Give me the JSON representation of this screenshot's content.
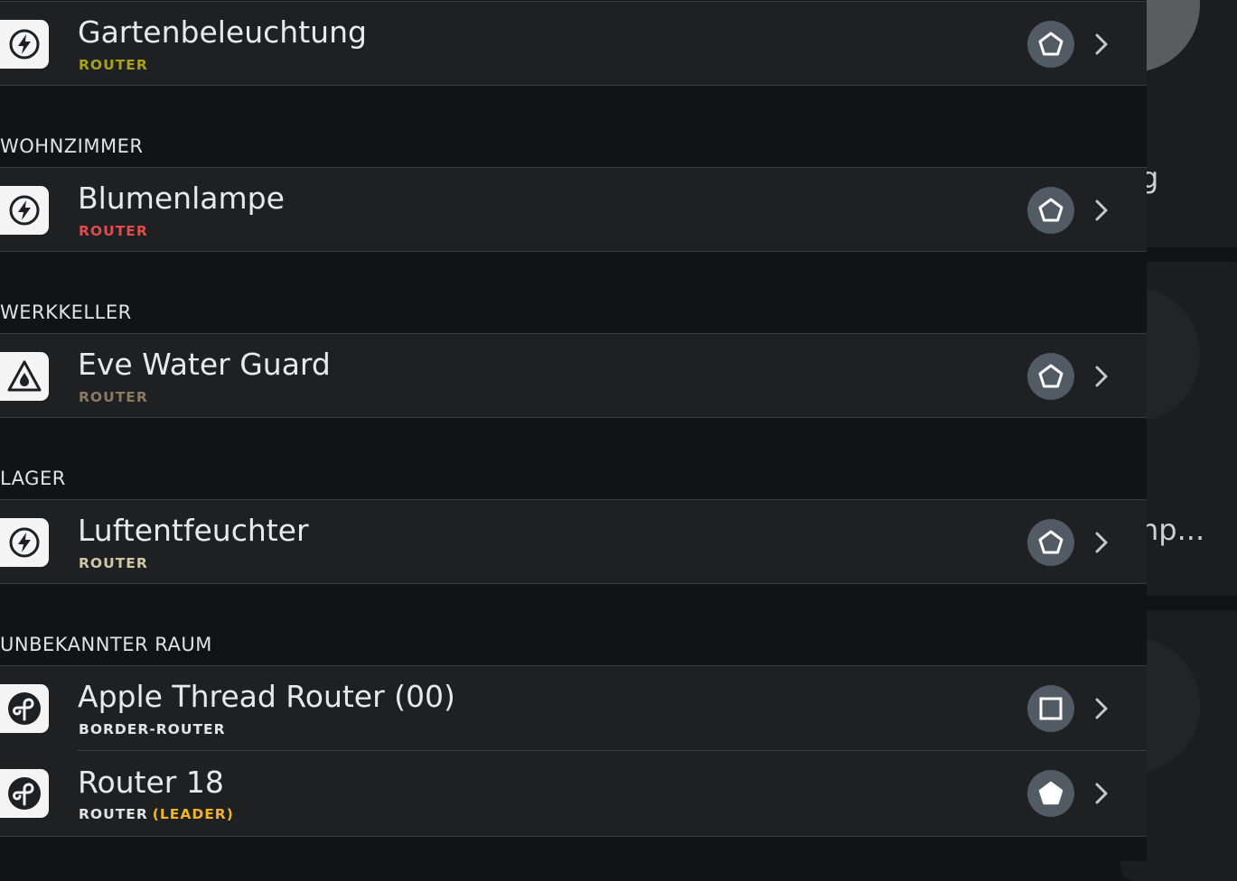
{
  "background": {
    "peek_text_1": "g",
    "peek_text_2": "np..."
  },
  "colors": {
    "row_bg": "#1e2022",
    "badge_bg": "#525a63",
    "accent_olive": "#a7a11f",
    "accent_red": "#e04b4b",
    "accent_brown": "#8a7a64",
    "accent_beige": "#cfc7a6",
    "accent_white": "#e3e3e3",
    "accent_orange": "#f2b22a"
  },
  "sections": [
    {
      "title": ""
    },
    {
      "title": "WOHNZIMMER"
    },
    {
      "title": "WERKKELLER"
    },
    {
      "title": "LAGER"
    },
    {
      "title": "UNBEKANNTER RAUM"
    }
  ],
  "devices": [
    {
      "name": "Gartenbeleuchtung",
      "role": "ROUTER",
      "role_extra": "",
      "icon": "bolt-icon",
      "state_icon": "pentagon-outline-icon"
    },
    {
      "name": "Blumenlampe",
      "role": "ROUTER",
      "role_extra": "",
      "icon": "bolt-icon",
      "state_icon": "pentagon-outline-icon"
    },
    {
      "name": "Eve Water Guard",
      "role": "ROUTER",
      "role_extra": "",
      "icon": "water-drop-icon",
      "state_icon": "pentagon-outline-icon"
    },
    {
      "name": "Luftentfeuchter",
      "role": "ROUTER",
      "role_extra": "",
      "icon": "bolt-icon",
      "state_icon": "pentagon-outline-icon"
    },
    {
      "name": "Apple Thread Router (00)",
      "role": "BORDER-ROUTER",
      "role_extra": "",
      "icon": "thread-icon",
      "state_icon": "square-outline-icon"
    },
    {
      "name": "Router 18",
      "role": "ROUTER",
      "role_extra": "(LEADER)",
      "icon": "thread-icon",
      "state_icon": "pentagon-filled-icon"
    }
  ]
}
